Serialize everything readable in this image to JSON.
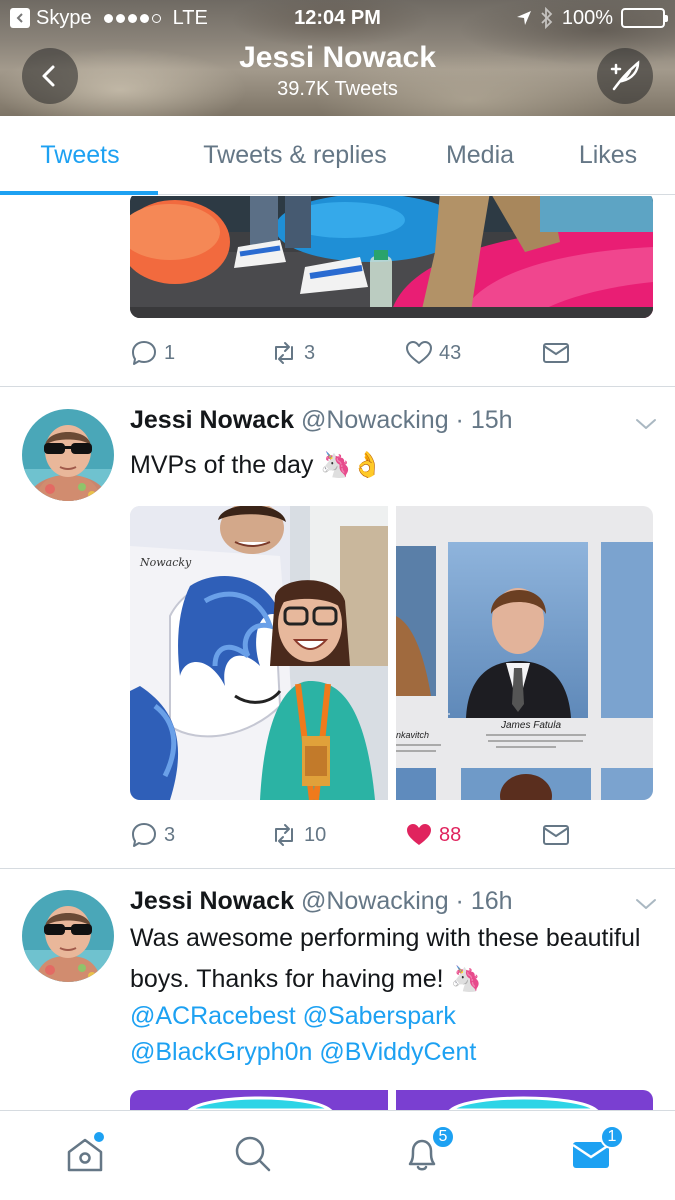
{
  "status_bar": {
    "back_app": "Skype",
    "carrier": "LTE",
    "time": "12:04 PM",
    "battery": "100%"
  },
  "header": {
    "name": "Jessi Nowack",
    "tweet_count": "39.7K Tweets"
  },
  "tabs": [
    {
      "label": "Tweets",
      "active": true
    },
    {
      "label": "Tweets & replies",
      "active": false
    },
    {
      "label": "Media",
      "active": false
    },
    {
      "label": "Likes",
      "active": false
    }
  ],
  "tweets": [
    {
      "replies": "1",
      "retweets": "3",
      "likes": "43",
      "liked": false
    },
    {
      "author": "Jessi Nowack",
      "handle": "@Nowacking",
      "time": "15h",
      "text": "MVPs of the day 🦄👌",
      "yearbook_caption": "James Fatula",
      "yearbook_partial_name": "nkavitch",
      "replies": "3",
      "retweets": "10",
      "likes": "88",
      "liked": true
    },
    {
      "author": "Jessi Nowack",
      "handle": "@Nowacking",
      "time": "16h",
      "text": "Was awesome performing with these beautiful boys. Thanks for having me! 🦄",
      "mentions_line1": "@ACRacebest @Saberspark",
      "mentions_line2": "@BlackGryph0n @BViddyCent"
    }
  ],
  "bottom_nav": {
    "notifications_badge": "5",
    "messages_badge": "1"
  },
  "colors": {
    "accent": "#1da1f2",
    "like": "#e0245e",
    "secondary_text": "#657786"
  }
}
